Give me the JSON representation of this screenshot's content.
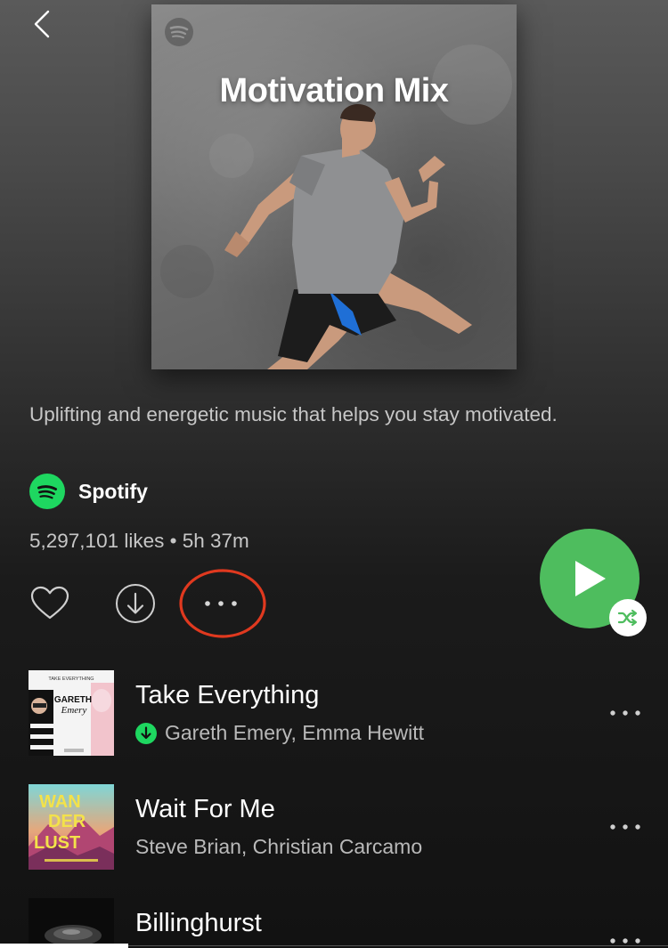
{
  "header": {
    "back_icon": "chevron-left-icon"
  },
  "playlist": {
    "cover_title": "Motivation Mix",
    "description": "Uplifting and energetic music that helps you stay motivated.",
    "owner": {
      "name": "Spotify",
      "avatar_icon": "spotify-logo-icon"
    },
    "stats": "5,297,101 likes • 5h 37m"
  },
  "actions": {
    "like_icon": "heart-icon",
    "download_icon": "download-circle-icon",
    "more_icon": "more-horizontal-icon",
    "more_highlight": "red-circle-annotation",
    "play_icon": "play-icon",
    "shuffle_icon": "shuffle-icon"
  },
  "tracks": [
    {
      "title": "Take Everything",
      "artists": "Gareth Emery, Emma Hewitt",
      "downloaded": true,
      "art": {
        "header_text": "TAKE EVERYTHING",
        "line1": "GARETH",
        "line2": "Emery"
      }
    },
    {
      "title": "Wait For Me",
      "artists": "Steve Brian, Christian Carcamo",
      "downloaded": false,
      "art": {
        "line1": "WAN",
        "line2": "DER",
        "line3": "LUST"
      }
    },
    {
      "title": "Billinghurst",
      "artists": "",
      "downloaded": false
    }
  ],
  "colors": {
    "accent_green": "#4ebd5e",
    "spotify_green": "#1ed760",
    "annotation_red": "#e0391f",
    "text_secondary": "#c7c7c7"
  }
}
